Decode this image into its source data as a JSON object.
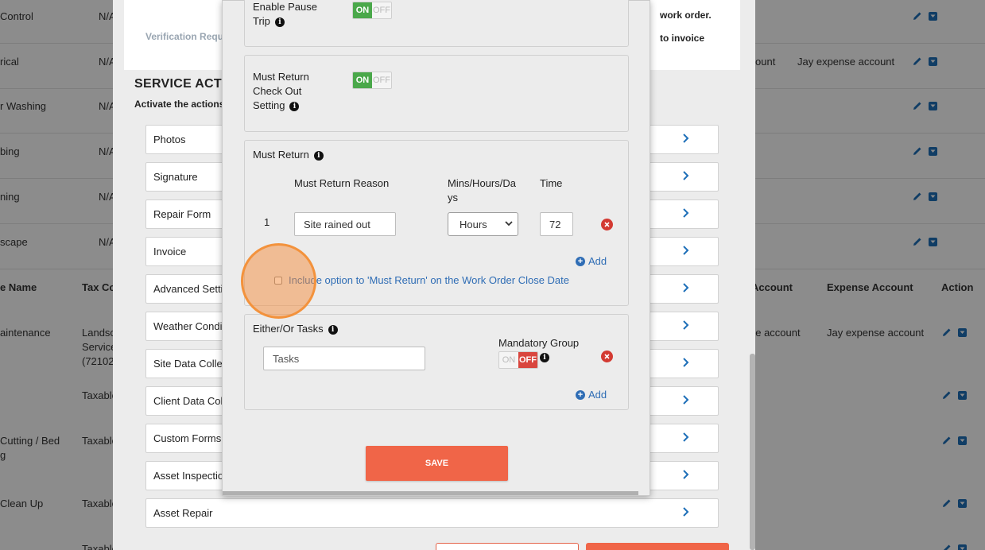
{
  "background_table": {
    "rows_top": [
      {
        "name": "Control",
        "tax": "N/A"
      },
      {
        "name": "rical",
        "tax": "N/A",
        "account": "ount",
        "expense": "Jay expense account"
      },
      {
        "name": "r Washing",
        "tax": "N/A"
      },
      {
        "name": "bing",
        "tax": "N/A"
      },
      {
        "name": "ning",
        "tax": "N/A"
      },
      {
        "name": "scape",
        "tax": "N/A"
      }
    ],
    "headers": {
      "name": "e Name",
      "tax": "Tax Co",
      "account": "Account",
      "expense": "Expense Account",
      "action": "Action"
    },
    "rows_bottom": [
      {
        "name": "aintenance",
        "tax_lines": [
          "Landsc",
          "Service",
          "(72102"
        ],
        "account": "ne account",
        "expense": "Jay expense account"
      },
      {
        "name": "",
        "tax_lines": [
          "Taxable"
        ]
      },
      {
        "name_lines": [
          "Cutting / Bed",
          "g"
        ],
        "tax_lines": [
          "Taxable"
        ]
      },
      {
        "name": "Clean Up",
        "tax_lines": [
          "Taxable"
        ]
      },
      {
        "name": "",
        "tax_lines": [
          "Taxable"
        ]
      }
    ]
  },
  "service_modal": {
    "verification_label": "Verification Requir",
    "right_text_1": "work order.",
    "right_text_2": "to invoice",
    "section_title": "SERVICE ACTIO",
    "section_subtitle": "Activate the actions",
    "actions": [
      "Photos",
      "Signature",
      "Repair Form",
      "Invoice",
      "Advanced Setti",
      "Weather Condit",
      "Site Data Collec",
      "Client Data Coll",
      "Custom Forms",
      "Asset Inspectio",
      "Asset Repair"
    ]
  },
  "detail_modal": {
    "pause_trip": {
      "label_line1": "Enable Pause",
      "label_line2": "Trip",
      "on": "ON",
      "off": "OFF",
      "state": "on"
    },
    "must_return_checkout": {
      "label_lines": [
        "Must Return",
        "Check Out",
        "Setting"
      ],
      "on": "ON",
      "off": "OFF",
      "state": "on"
    },
    "must_return": {
      "title": "Must Return",
      "col_reason": "Must Return Reason",
      "col_unit_line1": "Mins/Hours/Da",
      "col_unit_line2": "ys",
      "col_time": "Time",
      "rows": [
        {
          "index": "1",
          "reason": "Site rained out",
          "unit": "Hours",
          "time": "72"
        }
      ],
      "add_label": "Add",
      "checkbox_label": "Include option to 'Must Return' on the Work Order Close Date",
      "checkbox_checked": false
    },
    "either_or": {
      "title": "Either/Or Tasks",
      "tasks_placeholder": "Tasks",
      "mandatory_label": "Mandatory Group",
      "on": "ON",
      "off": "OFF",
      "state": "off",
      "add_label": "Add"
    },
    "save_label": "SAVE"
  },
  "colors": {
    "accent": "#f06548",
    "link": "#2f6db5",
    "on_green": "#4aa84a",
    "off_red": "#d9463e",
    "click_ring": "#f3923c"
  }
}
